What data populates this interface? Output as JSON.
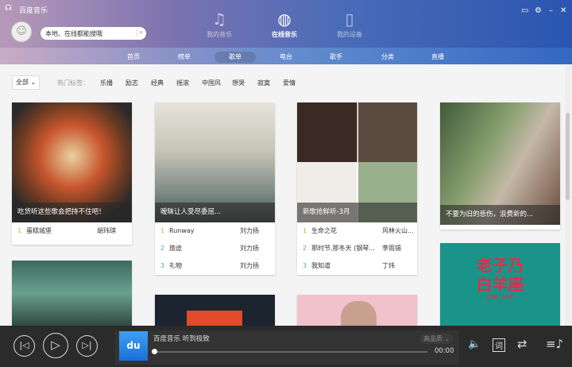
{
  "app": {
    "title": "百度音乐"
  },
  "search": {
    "placeholder": "本地、在线都能搜哦"
  },
  "top_nav": [
    {
      "label": "我的音乐",
      "icon": "music-note-icon"
    },
    {
      "label": "在线音乐",
      "icon": "globe-icon",
      "active": true
    },
    {
      "label": "我的设备",
      "icon": "device-icon"
    }
  ],
  "sub_nav": [
    {
      "label": "首页"
    },
    {
      "label": "榜单"
    },
    {
      "label": "歌单",
      "active": true
    },
    {
      "label": "电台"
    },
    {
      "label": "歌手"
    },
    {
      "label": "分类"
    },
    {
      "label": "直播"
    }
  ],
  "filter": {
    "all": "全部",
    "hot_label": "热门标签：",
    "tags": [
      "乐播",
      "励志",
      "经典",
      "摇滚",
      "中国风",
      "想哭",
      "寂寞",
      "爱情"
    ]
  },
  "playlists": [
    {
      "caption": "吃货听这些歌会把持不住吧！",
      "tracks": [
        {
          "n": "1",
          "title": "蛋糕城堡",
          "artist": "胡玮琪"
        }
      ]
    },
    {
      "caption": "暧昧让人受尽委屈...",
      "tracks": [
        {
          "n": "1",
          "title": "Runway",
          "artist": "刘力扬"
        },
        {
          "n": "2",
          "title": "旅途",
          "artist": "刘力扬"
        },
        {
          "n": "3",
          "title": "礼物",
          "artist": "刘力扬"
        }
      ]
    },
    {
      "caption": "新歌抢鲜听-3月",
      "tracks": [
        {
          "n": "1",
          "title": "生命之花",
          "artist": "风林火山..."
        },
        {
          "n": "2",
          "title": "那时节,那冬天 (钢琴...",
          "artist": "李雨锡"
        },
        {
          "n": "3",
          "title": "我知道",
          "artist": "丁炜"
        }
      ]
    },
    {
      "caption": "不要为旧的悲伤，浪费新的...",
      "tracks": []
    }
  ],
  "second_row": {
    "teal_card_text": "老子乃白羊座",
    "teal_card_sub": "OH! AH!"
  },
  "player": {
    "title": "百度音乐 听到极致",
    "quality": "高品质",
    "time": "00:00",
    "progress": 0,
    "logo": "du"
  }
}
